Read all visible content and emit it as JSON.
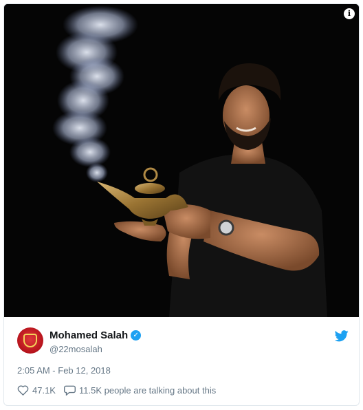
{
  "tweet": {
    "media": {
      "alt": "",
      "info_icon": "info-circle-icon"
    },
    "author": {
      "name": "Mohamed Salah",
      "handle": "@22mosalah",
      "verified": true,
      "verified_icon": "verified-badge-icon",
      "avatar_icon": "liverpool-crest-avatar"
    },
    "platform_icon": "twitter-bird-icon",
    "timestamp": "2:05 AM - Feb 12, 2018",
    "likes": "47.1K",
    "like_icon": "heart-icon",
    "talking": "11.5K people are talking about this",
    "talking_icon": "speech-bubble-icon",
    "colors": {
      "accent": "#1da1f2",
      "secondary_text": "#657786",
      "border": "#e1e8ed"
    }
  }
}
